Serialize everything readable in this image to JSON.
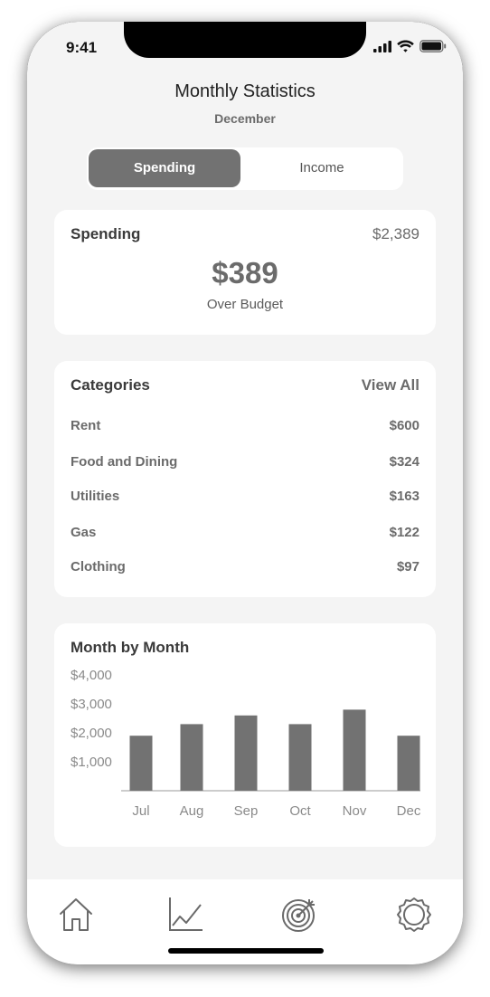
{
  "status_bar": {
    "time": "9:41",
    "icons": [
      "cellular-signal-icon",
      "wifi-icon",
      "battery-icon"
    ]
  },
  "header": {
    "title": "Monthly Statistics",
    "subtitle": "December"
  },
  "segmented_control": {
    "options": [
      "Spending",
      "Income"
    ],
    "selected": "Spending"
  },
  "spending_card": {
    "title": "Spending",
    "total": "$2,389",
    "amount": "$389",
    "status": "Over Budget"
  },
  "categories_card": {
    "title": "Categories",
    "view_all_label": "View All",
    "items": [
      {
        "name": "Rent",
        "amount": "$600"
      },
      {
        "name": "Food and Dining",
        "amount": "$324"
      },
      {
        "name": "Utilities",
        "amount": "$163"
      },
      {
        "name": "Gas",
        "amount": "$122"
      },
      {
        "name": "Clothing",
        "amount": "$97"
      }
    ]
  },
  "chart_card": {
    "title": "Month by Month"
  },
  "chart_data": {
    "type": "bar",
    "title": "Month by Month",
    "categories": [
      "Jul",
      "Aug",
      "Sep",
      "Oct",
      "Nov",
      "Dec"
    ],
    "values": [
      1900,
      2300,
      2600,
      2300,
      2800,
      1900
    ],
    "y_tick_values": [
      1000,
      2000,
      3000,
      4000
    ],
    "y_tick_labels": [
      "$1,000",
      "$2,000",
      "$3,000",
      "$4,000"
    ],
    "ylim": [
      0,
      4000
    ],
    "bar_color": "#727272",
    "grid": false
  },
  "tab_bar": {
    "items": [
      {
        "name": "home-icon"
      },
      {
        "name": "chart-icon"
      },
      {
        "name": "target-icon"
      },
      {
        "name": "settings-icon"
      }
    ]
  },
  "colors": {
    "background": "#f4f4f4",
    "card": "#ffffff",
    "accent": "#727272",
    "text_dark": "#3a3a3a",
    "text_muted": "#6b6b6b"
  }
}
